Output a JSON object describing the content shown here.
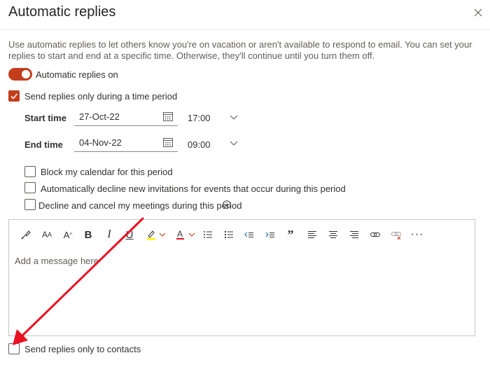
{
  "dialog": {
    "title": "Automatic replies",
    "description": "Use automatic replies to let others know you're on vacation or aren't available to respond to email. You can set your replies to start and end at a specific time. Otherwise, they'll continue until you turn them off."
  },
  "toggle": {
    "label": "Automatic replies on",
    "state": "on"
  },
  "time_period": {
    "label": "Send replies only during a time period",
    "checked": true
  },
  "start": {
    "label": "Start time",
    "date": "27-Oct-22",
    "time": "17:00"
  },
  "end": {
    "label": "End time",
    "date": "04-Nov-22",
    "time": "09:00"
  },
  "options": [
    {
      "label": "Block my calendar for this period",
      "checked": false
    },
    {
      "label": "Automatically decline new invitations for events that occur during this period",
      "checked": false
    },
    {
      "label": "Decline and cancel my meetings during this period",
      "checked": false
    }
  ],
  "editor": {
    "placeholder": "Add a message here",
    "toolbar": [
      "format-painter-icon",
      "font-size-icon",
      "grow-font-icon",
      "bold-icon",
      "italic-icon",
      "underline-icon",
      "highlight-icon",
      "font-color-icon",
      "bullets-icon",
      "numbering-icon",
      "decrease-indent-icon",
      "increase-indent-icon",
      "quote-icon",
      "align-left-icon",
      "align-center-icon",
      "align-right-icon",
      "link-icon",
      "unlink-icon",
      "more-icon"
    ]
  },
  "contacts_only": {
    "label": "Send replies only to contacts",
    "checked": false
  },
  "colors": {
    "accent": "#c43e1c",
    "annotation_arrow": "#e81123"
  }
}
